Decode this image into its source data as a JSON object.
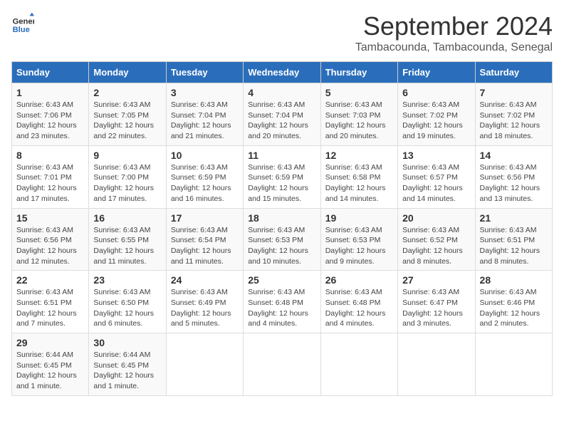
{
  "logo": {
    "line1": "General",
    "line2": "Blue"
  },
  "title": "September 2024",
  "location": "Tambacounda, Tambacounda, Senegal",
  "days_of_week": [
    "Sunday",
    "Monday",
    "Tuesday",
    "Wednesday",
    "Thursday",
    "Friday",
    "Saturday"
  ],
  "weeks": [
    [
      {
        "day": "1",
        "sunrise": "6:43 AM",
        "sunset": "7:06 PM",
        "daylight": "12 hours and 23 minutes."
      },
      {
        "day": "2",
        "sunrise": "6:43 AM",
        "sunset": "7:05 PM",
        "daylight": "12 hours and 22 minutes."
      },
      {
        "day": "3",
        "sunrise": "6:43 AM",
        "sunset": "7:04 PM",
        "daylight": "12 hours and 21 minutes."
      },
      {
        "day": "4",
        "sunrise": "6:43 AM",
        "sunset": "7:04 PM",
        "daylight": "12 hours and 20 minutes."
      },
      {
        "day": "5",
        "sunrise": "6:43 AM",
        "sunset": "7:03 PM",
        "daylight": "12 hours and 20 minutes."
      },
      {
        "day": "6",
        "sunrise": "6:43 AM",
        "sunset": "7:02 PM",
        "daylight": "12 hours and 19 minutes."
      },
      {
        "day": "7",
        "sunrise": "6:43 AM",
        "sunset": "7:02 PM",
        "daylight": "12 hours and 18 minutes."
      }
    ],
    [
      {
        "day": "8",
        "sunrise": "6:43 AM",
        "sunset": "7:01 PM",
        "daylight": "12 hours and 17 minutes."
      },
      {
        "day": "9",
        "sunrise": "6:43 AM",
        "sunset": "7:00 PM",
        "daylight": "12 hours and 17 minutes."
      },
      {
        "day": "10",
        "sunrise": "6:43 AM",
        "sunset": "6:59 PM",
        "daylight": "12 hours and 16 minutes."
      },
      {
        "day": "11",
        "sunrise": "6:43 AM",
        "sunset": "6:59 PM",
        "daylight": "12 hours and 15 minutes."
      },
      {
        "day": "12",
        "sunrise": "6:43 AM",
        "sunset": "6:58 PM",
        "daylight": "12 hours and 14 minutes."
      },
      {
        "day": "13",
        "sunrise": "6:43 AM",
        "sunset": "6:57 PM",
        "daylight": "12 hours and 14 minutes."
      },
      {
        "day": "14",
        "sunrise": "6:43 AM",
        "sunset": "6:56 PM",
        "daylight": "12 hours and 13 minutes."
      }
    ],
    [
      {
        "day": "15",
        "sunrise": "6:43 AM",
        "sunset": "6:56 PM",
        "daylight": "12 hours and 12 minutes."
      },
      {
        "day": "16",
        "sunrise": "6:43 AM",
        "sunset": "6:55 PM",
        "daylight": "12 hours and 11 minutes."
      },
      {
        "day": "17",
        "sunrise": "6:43 AM",
        "sunset": "6:54 PM",
        "daylight": "12 hours and 11 minutes."
      },
      {
        "day": "18",
        "sunrise": "6:43 AM",
        "sunset": "6:53 PM",
        "daylight": "12 hours and 10 minutes."
      },
      {
        "day": "19",
        "sunrise": "6:43 AM",
        "sunset": "6:53 PM",
        "daylight": "12 hours and 9 minutes."
      },
      {
        "day": "20",
        "sunrise": "6:43 AM",
        "sunset": "6:52 PM",
        "daylight": "12 hours and 8 minutes."
      },
      {
        "day": "21",
        "sunrise": "6:43 AM",
        "sunset": "6:51 PM",
        "daylight": "12 hours and 8 minutes."
      }
    ],
    [
      {
        "day": "22",
        "sunrise": "6:43 AM",
        "sunset": "6:51 PM",
        "daylight": "12 hours and 7 minutes."
      },
      {
        "day": "23",
        "sunrise": "6:43 AM",
        "sunset": "6:50 PM",
        "daylight": "12 hours and 6 minutes."
      },
      {
        "day": "24",
        "sunrise": "6:43 AM",
        "sunset": "6:49 PM",
        "daylight": "12 hours and 5 minutes."
      },
      {
        "day": "25",
        "sunrise": "6:43 AM",
        "sunset": "6:48 PM",
        "daylight": "12 hours and 4 minutes."
      },
      {
        "day": "26",
        "sunrise": "6:43 AM",
        "sunset": "6:48 PM",
        "daylight": "12 hours and 4 minutes."
      },
      {
        "day": "27",
        "sunrise": "6:43 AM",
        "sunset": "6:47 PM",
        "daylight": "12 hours and 3 minutes."
      },
      {
        "day": "28",
        "sunrise": "6:43 AM",
        "sunset": "6:46 PM",
        "daylight": "12 hours and 2 minutes."
      }
    ],
    [
      {
        "day": "29",
        "sunrise": "6:44 AM",
        "sunset": "6:45 PM",
        "daylight": "12 hours and 1 minute."
      },
      {
        "day": "30",
        "sunrise": "6:44 AM",
        "sunset": "6:45 PM",
        "daylight": "12 hours and 1 minute."
      },
      null,
      null,
      null,
      null,
      null
    ]
  ],
  "labels": {
    "sunrise": "Sunrise:",
    "sunset": "Sunset:",
    "daylight": "Daylight:"
  }
}
